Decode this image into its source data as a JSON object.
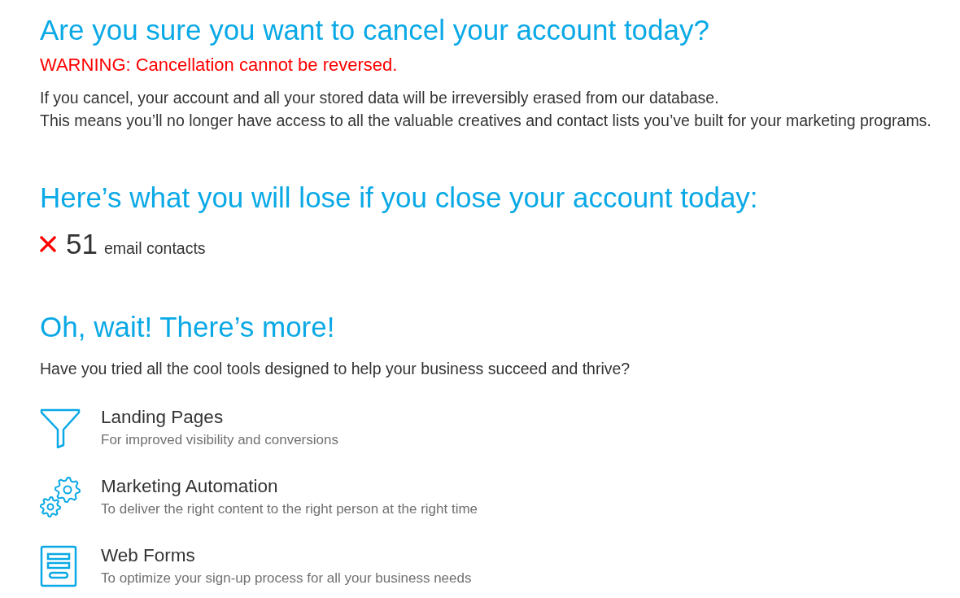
{
  "title": "Are you sure you want to cancel your account today?",
  "warning": "WARNING: Cancellation cannot be reversed.",
  "explanation": [
    "If you cancel, your account and all your stored data will be irreversibly erased from our database.",
    "This means you’ll no longer have access to all the valuable creatives and contact lists you’ve built for your marketing programs."
  ],
  "losses": {
    "heading": "Here’s what you will lose if you close your account today:",
    "items": [
      {
        "count": "51",
        "label": "email contacts"
      }
    ]
  },
  "more": {
    "heading": "Oh, wait! There’s more!",
    "intro": "Have you tried all the cool tools designed to help your business succeed and thrive?",
    "tools": [
      {
        "title": "Landing Pages",
        "description": "For improved visibility and conversions"
      },
      {
        "title": "Marketing Automation",
        "description": "To deliver the right content to the right person at the right time"
      },
      {
        "title": "Web Forms",
        "description": "To optimize your sign-up process for all your business needs"
      }
    ]
  }
}
